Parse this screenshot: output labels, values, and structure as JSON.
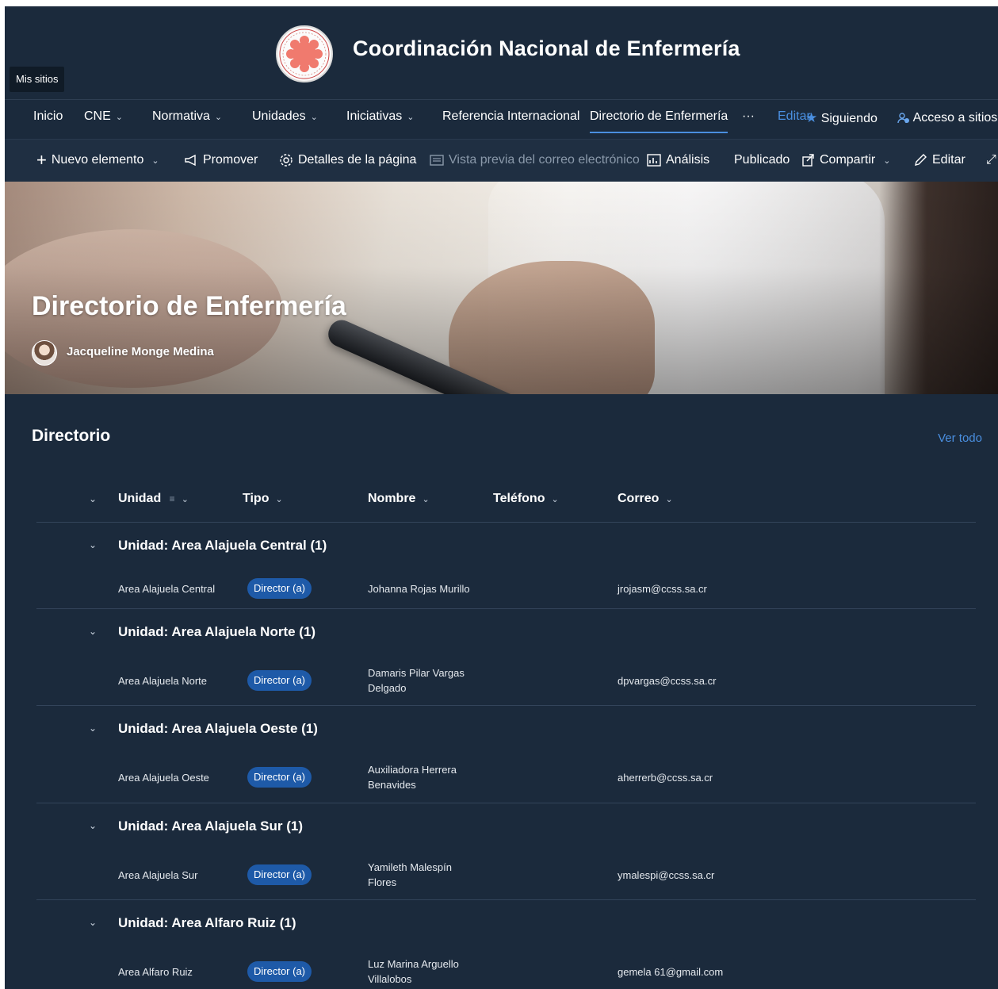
{
  "site": {
    "my_sites": "Mis sitios",
    "title": "Coordinación Nacional de Enfermería"
  },
  "nav": {
    "items": [
      "Inicio",
      "CNE",
      "Normativa",
      "Unidades",
      "Iniciativas",
      "Referencia Internacional",
      "Directorio de Enfermería"
    ],
    "more": "···",
    "edit": "Editar",
    "following": "Siguiendo",
    "site_access": "Acceso a sitios"
  },
  "commands": {
    "new_item": "Nuevo elemento",
    "promote": "Promover",
    "page_details": "Detalles de la página",
    "email_preview": "Vista previa del correo electrónico",
    "analytics": "Análisis",
    "published": "Publicado",
    "share": "Compartir",
    "edit": "Editar"
  },
  "hero": {
    "title": "Directorio de Enfermería",
    "author": "Jacqueline Monge Medina"
  },
  "directory": {
    "title": "Directorio",
    "see_all": "Ver todo",
    "columns": {
      "unit": "Unidad",
      "type": "Tipo",
      "name": "Nombre",
      "phone": "Teléfono",
      "email": "Correo"
    },
    "groups": [
      {
        "title": "Unidad: Area Alajuela Central (1)",
        "unit": "Area Alajuela Central",
        "type": "Director (a)",
        "name_line1": "Johanna Rojas Murillo",
        "name_line2": "",
        "email": "jrojasm@ccss.sa.cr"
      },
      {
        "title": "Unidad: Area Alajuela Norte (1)",
        "unit": "Area Alajuela Norte",
        "type": "Director (a)",
        "name_line1": "Damaris Pilar Vargas",
        "name_line2": "Delgado",
        "email": "dpvargas@ccss.sa.cr"
      },
      {
        "title": "Unidad: Area Alajuela Oeste (1)",
        "unit": "Area Alajuela Oeste",
        "type": "Director (a)",
        "name_line1": "Auxiliadora Herrera",
        "name_line2": "Benavides",
        "email": "aherrerb@ccss.sa.cr"
      },
      {
        "title": "Unidad: Area Alajuela Sur (1)",
        "unit": "Area Alajuela Sur",
        "type": "Director (a)",
        "name_line1": "Yamileth Malespín",
        "name_line2": "Flores",
        "email": "ymalespi@ccss.sa.cr"
      },
      {
        "title": "Unidad: Area Alfaro Ruiz (1)",
        "unit": "Area Alfaro Ruiz",
        "type": "Director (a)",
        "name_line1": "Luz Marina Arguello",
        "name_line2": "Villalobos",
        "email": "gemela 61@gmail.com"
      }
    ]
  }
}
